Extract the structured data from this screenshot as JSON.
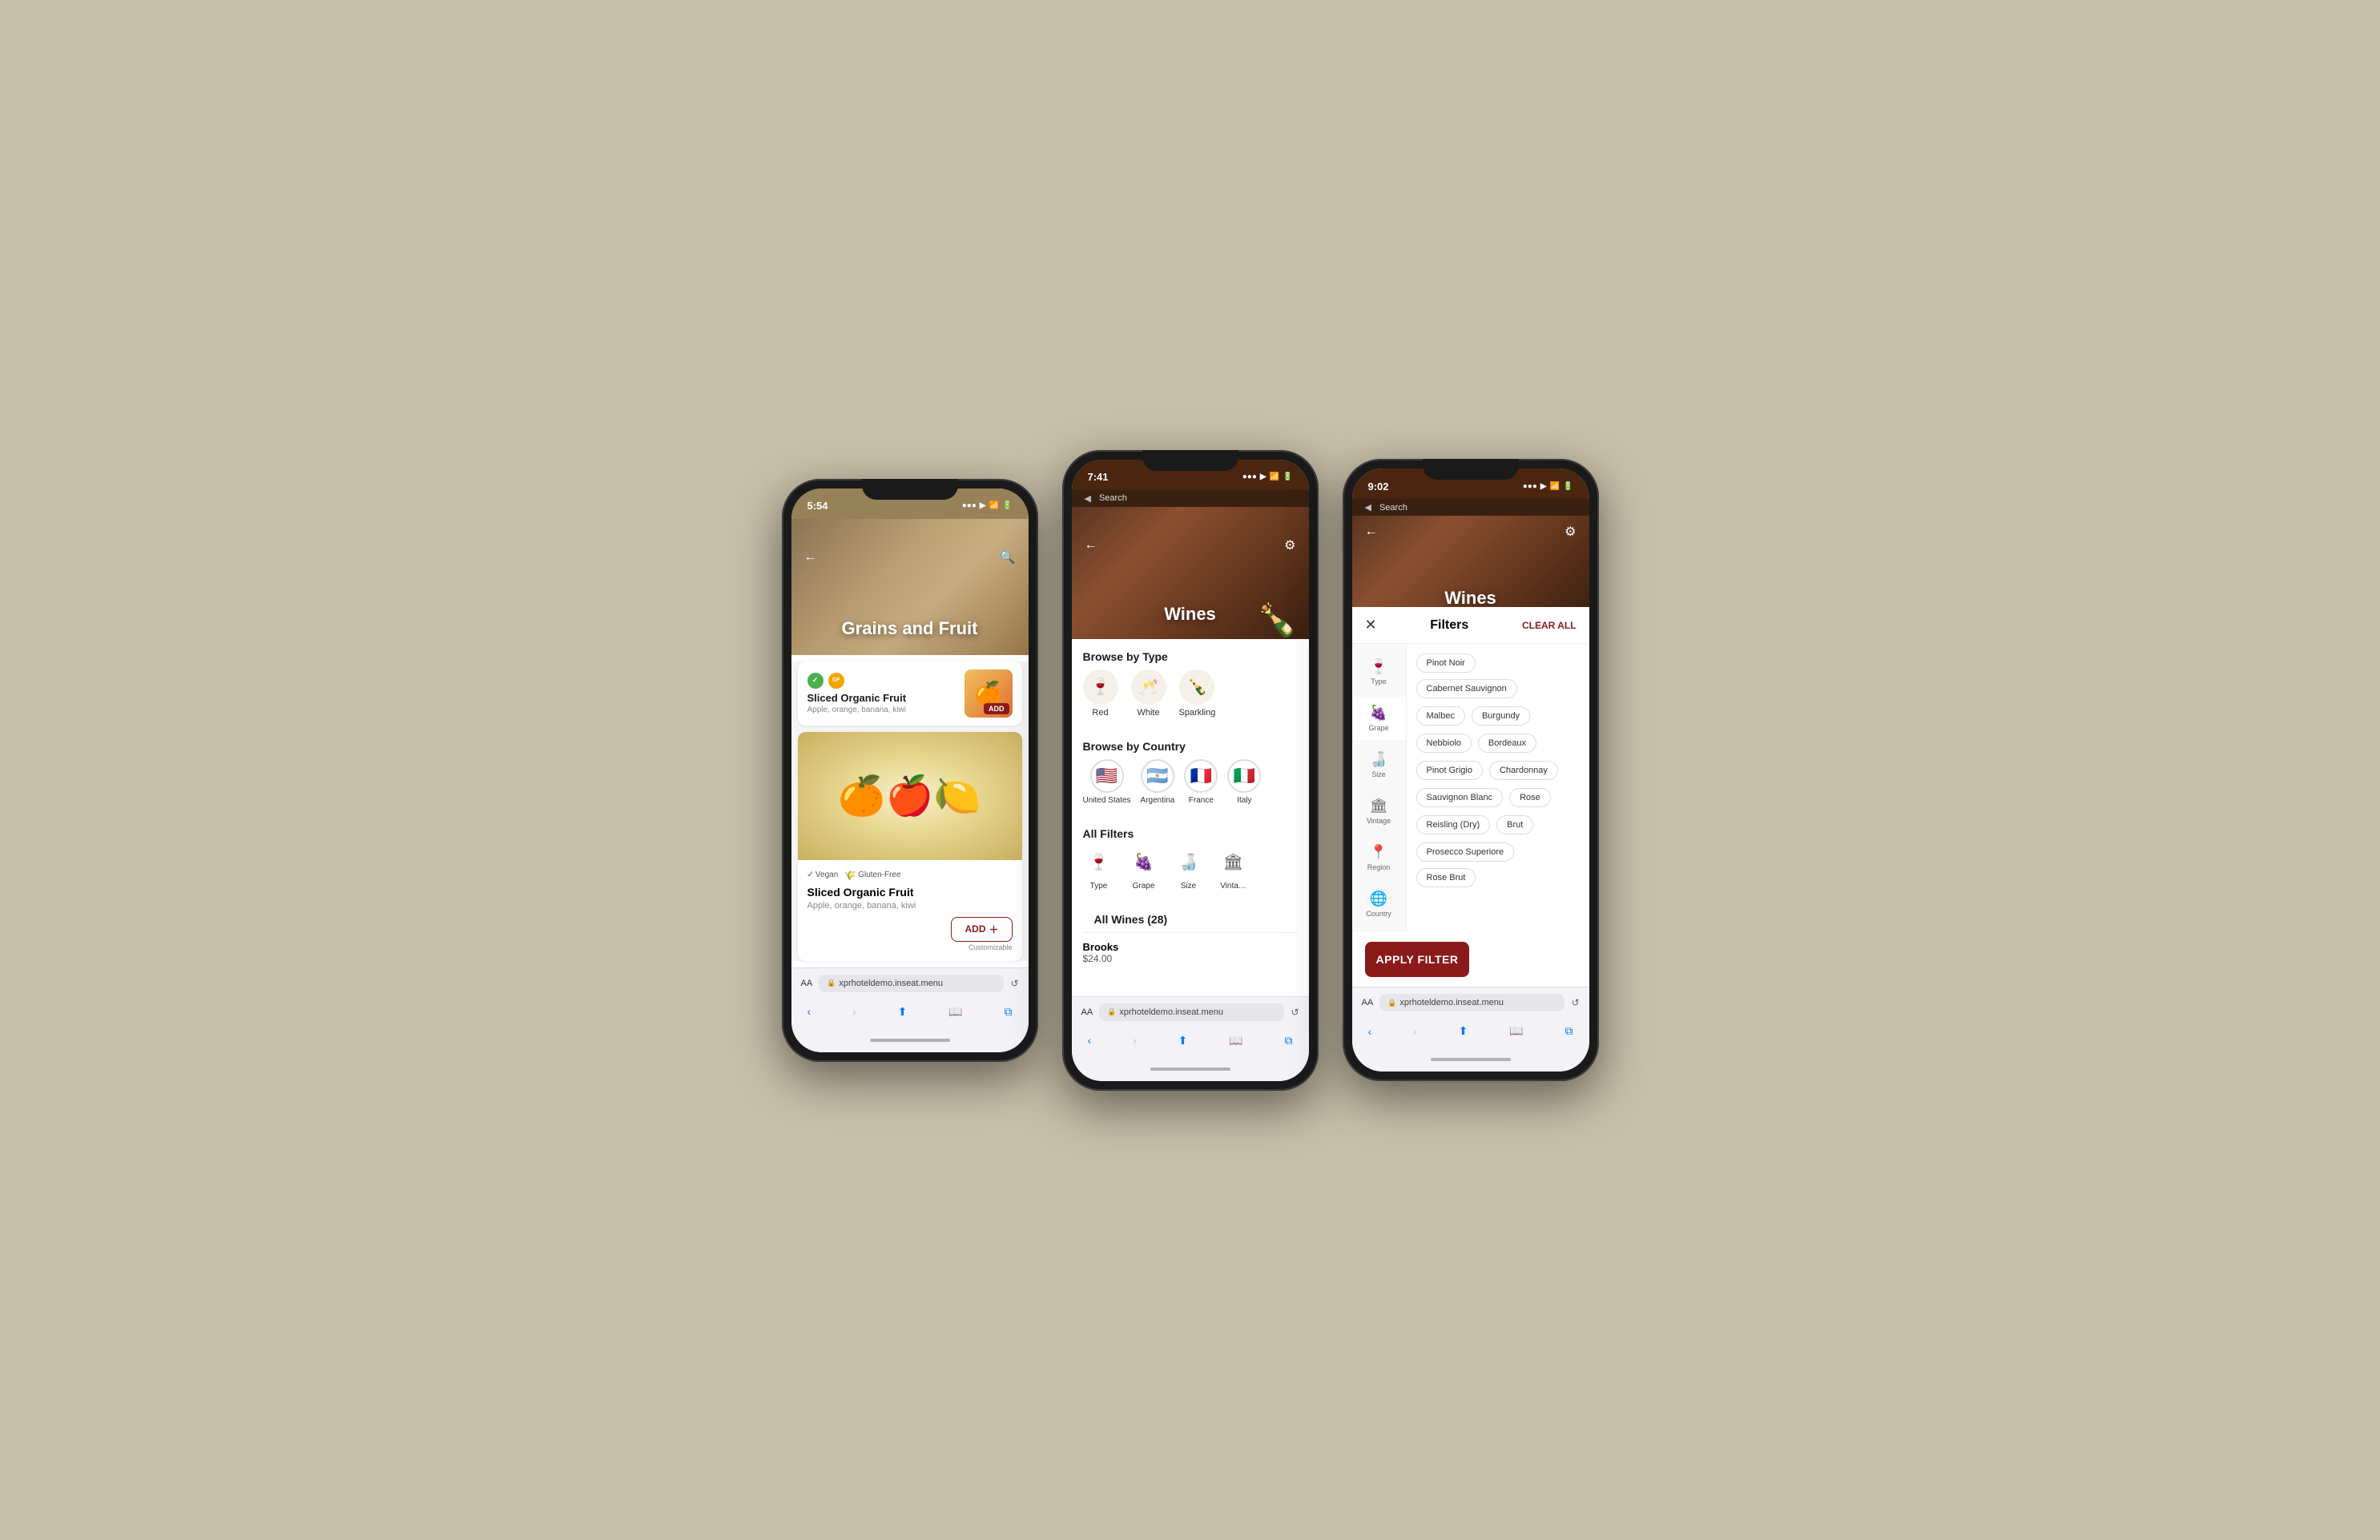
{
  "phone1": {
    "status_time": "5:54",
    "category_title": "Grains and Fruit",
    "nav_back": "←",
    "nav_search": "🔍",
    "item1": {
      "name": "Sliced Organic Fruit",
      "description": "Apple, orange, banana, kiwi",
      "badge_vegan": "✓",
      "badge_gf": "GF",
      "add_label": "ADD"
    },
    "item2": {
      "name": "Sliced Organic Fruit",
      "description": "Apple, orange, banana, kiwi",
      "badge_vegan_label": "Vegan",
      "badge_gf_label": "Gluten-Free",
      "add_label": "ADD",
      "customizable": "Customizable"
    },
    "url": "xprhoteldemo.inseat.menu"
  },
  "phone2": {
    "status_time": "7:41",
    "status_bar_text": "Search",
    "nav_back": "←",
    "page_title": "Wines",
    "browse_type_title": "Browse by Type",
    "types": [
      {
        "label": "Red",
        "icon": "🍷"
      },
      {
        "label": "White",
        "icon": "🥂"
      },
      {
        "label": "Sparkling",
        "icon": "🍾"
      }
    ],
    "browse_country_title": "Browse by Country",
    "countries": [
      {
        "label": "United States",
        "flag": "🇺🇸"
      },
      {
        "label": "Argentina",
        "flag": "🇦🇷"
      },
      {
        "label": "France",
        "flag": "🇫🇷"
      },
      {
        "label": "Italy",
        "flag": "🇮🇹"
      }
    ],
    "all_filters_title": "All Filters",
    "filters": [
      {
        "label": "Type",
        "icon": "🍷"
      },
      {
        "label": "Grape",
        "icon": "🍇"
      },
      {
        "label": "Size",
        "icon": "🍶"
      },
      {
        "label": "Vinta…",
        "icon": "🏛"
      }
    ],
    "all_wines_title": "All Wines (28)",
    "wines": [
      {
        "name": "Brooks",
        "price": "$24.00"
      }
    ],
    "url": "xprhoteldemo.inseat.menu"
  },
  "phone3": {
    "status_time": "9:02",
    "status_bar_text": "Search",
    "nav_back": "←",
    "page_title": "Wines",
    "filters_title": "Filters",
    "clear_all": "CLEAR ALL",
    "sidebar_items": [
      {
        "label": "Type",
        "icon": "🍷"
      },
      {
        "label": "Grape",
        "icon": "🍇"
      },
      {
        "label": "Size",
        "icon": "🍶"
      },
      {
        "label": "Vintage",
        "icon": "🏛"
      },
      {
        "label": "Region",
        "icon": "📍"
      },
      {
        "label": "Country",
        "icon": "🌐"
      }
    ],
    "filter_chips": [
      "Pinot Noir",
      "Cabernet Sauvignon",
      "Malbec",
      "Burgundy",
      "Nebbiolo",
      "Bordeaux",
      "Pinot Grigio",
      "Chardonnay",
      "Sauvignon Blanc",
      "Rose",
      "Reisling (Dry)",
      "Brut",
      "Prosecco Superiore",
      "Rose Brut"
    ],
    "apply_label": "APPLY FILTER",
    "url": "xprhoteldemo.inseat.menu"
  }
}
